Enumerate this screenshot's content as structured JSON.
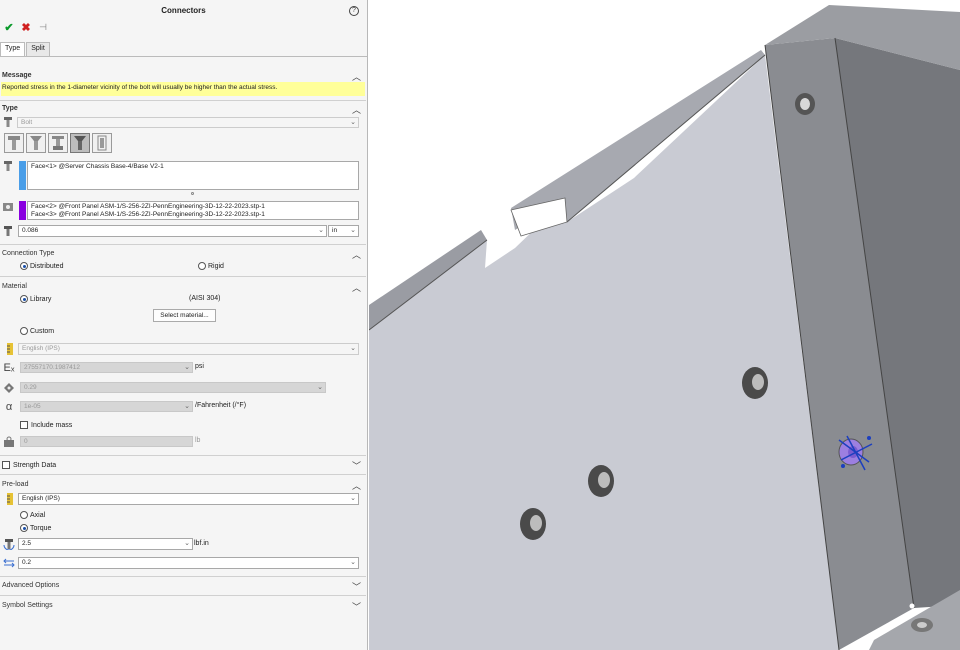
{
  "panel": {
    "title": "Connectors",
    "tabs": [
      "Type",
      "Split"
    ],
    "message_header": "Message",
    "message": "Reported stress in the 1-diameter vicinity of the bolt will usually be higher than the actual stress.",
    "type_header": "Type",
    "bolt_type": "Bolt",
    "face1": "Face<1> @Server Chassis Base-4/Base V2-1",
    "face2": "Face<2> @Front Panel ASM-1/S-256-2ZI-PennEngineering-3D-12-22-2023.stp-1",
    "face3": "Face<3> @Front Panel ASM-1/S-256-2ZI-PennEngineering-3D-12-22-2023.stp-1",
    "diameter": "0.086",
    "diameter_unit": "in",
    "connection_header": "Connection Type",
    "conn_distributed": "Distributed",
    "conn_rigid": "Rigid",
    "material_header": "Material",
    "mat_library": "Library",
    "mat_library_value": "(AISI 304)",
    "select_material": "Select material...",
    "mat_custom": "Custom",
    "mat_units": "English (IPS)",
    "modulus": "27557170.1987412",
    "modulus_unit": "psi",
    "poisson": "0.29",
    "thermal": "1e-05",
    "thermal_unit": "/Fahrenheit (/°F)",
    "include_mass": "Include mass",
    "mass": "0",
    "mass_unit": "lb",
    "strength_header": "Strength Data",
    "preload_header": "Pre-load",
    "preload_units": "English (IPS)",
    "preload_axial": "Axial",
    "preload_torque": "Torque",
    "torque_value": "2.5",
    "torque_unit": "lbf.in",
    "friction": "0.2",
    "advanced_header": "Advanced Options",
    "symbol_header": "Symbol Settings"
  },
  "colors": {
    "message_bg": "#ffff99",
    "face1_marker": "#4a9ee8",
    "face2_marker": "#8a00e0",
    "panel_fill": "#c9cbd3",
    "side_fill": "#86888c",
    "radio_accent": "#1a4fa8"
  },
  "icons": [
    "ok-icon",
    "cancel-icon",
    "pin-icon",
    "help-icon",
    "bolt-icon",
    "nut-icon",
    "diameter-icon",
    "material-icon",
    "modulus-icon",
    "poisson-icon",
    "alpha-icon",
    "mass-icon",
    "friction-icon"
  ]
}
